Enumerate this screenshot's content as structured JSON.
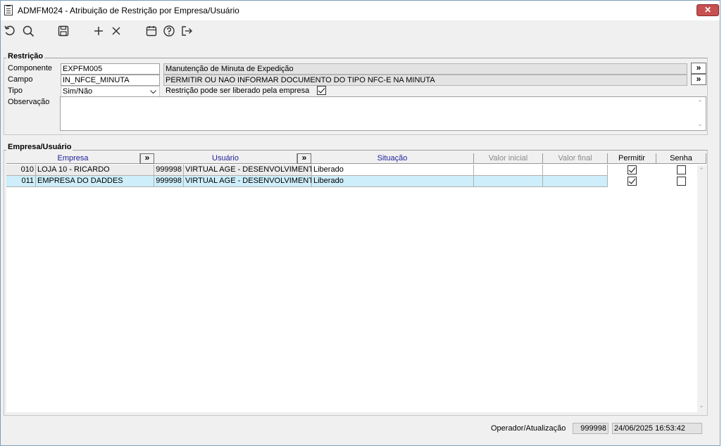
{
  "window": {
    "title": "ADMFM024 - Atribuição de Restrição por Empresa/Usuário",
    "close_label": "✕"
  },
  "toolbar": {
    "icons": [
      "refresh-icon",
      "search-icon",
      "save-icon",
      "add-icon",
      "delete-icon",
      "calendar-icon",
      "help-icon",
      "exit-icon"
    ]
  },
  "restricao": {
    "legend": "Restrição",
    "componente_label": "Componente",
    "componente_value": "EXPFM005",
    "componente_desc": "Manutenção de Minuta de Expedição",
    "campo_label": "Campo",
    "campo_value": "IN_NFCE_MINUTA",
    "campo_desc": "PERMITIR OU NAO INFORMAR DOCUMENTO DO TIPO NFC-E NA MINUTA",
    "tipo_label": "Tipo",
    "tipo_value": "Sim/Não",
    "liberado_label": "Restrição pode ser liberado pela empresa",
    "liberado_checked": true,
    "observacao_label": "Observação",
    "observacao_value": "",
    "more_label": "»"
  },
  "empresa_usuario": {
    "legend": "Empresa/Usuário",
    "columns": {
      "empresa": "Empresa",
      "usuario": "Usuário",
      "situacao": "Situação",
      "valor_inicial": "Valor inicial",
      "valor_final": "Valor final",
      "permitir": "Permitir",
      "senha": "Senha"
    },
    "more_label": "»",
    "rows": [
      {
        "empresa_cod": "010",
        "empresa_nome": "LOJA 10 - RICARDO",
        "usuario_cod": "999998",
        "usuario_nome": "VIRTUAL AGE - DESENVOLVIMENTO",
        "situacao": "Liberado",
        "valor_inicial": "",
        "valor_final": "",
        "permitir": true,
        "senha": false
      },
      {
        "empresa_cod": "011",
        "empresa_nome": "EMPRESA DO DADDES",
        "usuario_cod": "999998",
        "usuario_nome": "VIRTUAL AGE - DESENVOLVIMENTO",
        "situacao": "Liberado",
        "valor_inicial": "",
        "valor_final": "",
        "permitir": true,
        "senha": false
      }
    ]
  },
  "footer": {
    "label": "Operador/Atualização",
    "operador": "999998",
    "atualizacao": "24/06/2025 16:53:42"
  }
}
